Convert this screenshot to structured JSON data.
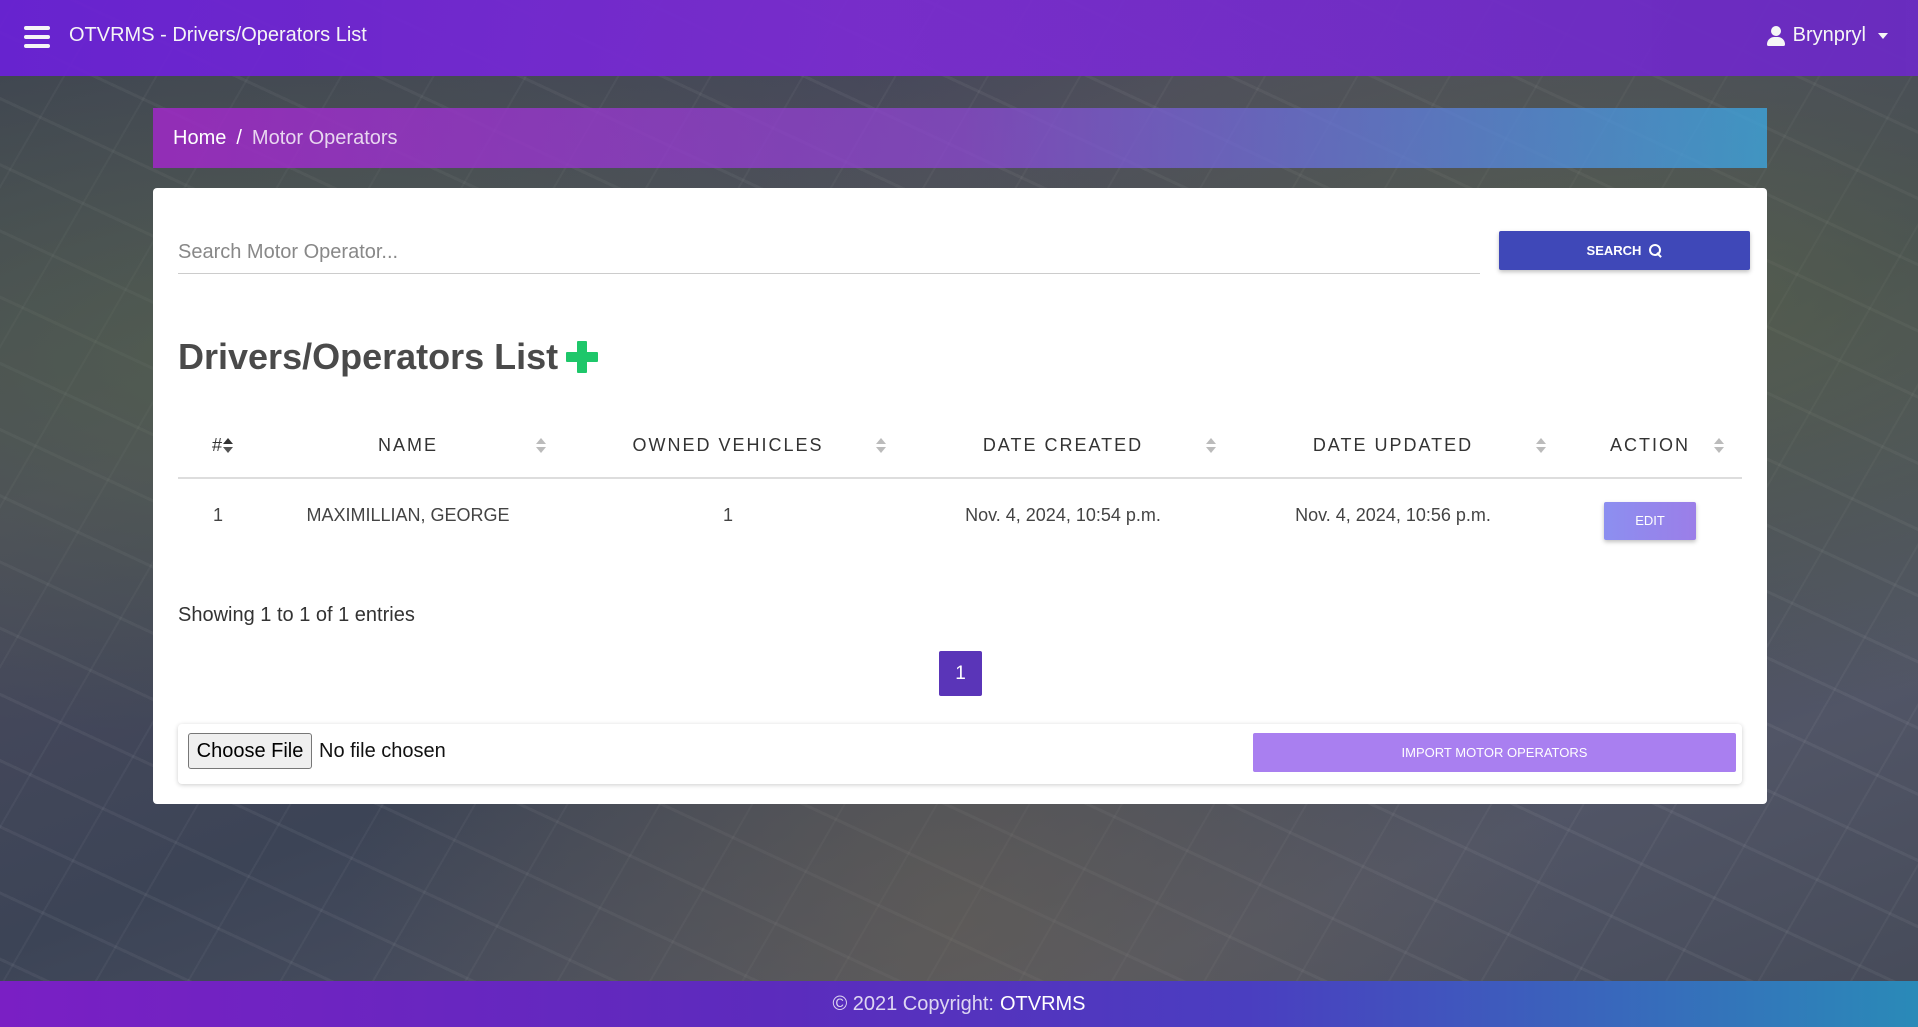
{
  "navbar": {
    "title": "OTVRMS - Drivers/Operators List",
    "user": "Brynpryl"
  },
  "breadcrumb": {
    "home": "Home",
    "separator": "/",
    "current": "Motor Operators"
  },
  "search": {
    "placeholder": "Search Motor Operator...",
    "button_label": "SEARCH"
  },
  "list": {
    "title": "Drivers/Operators List",
    "columns": [
      "#",
      "NAME",
      "OWNED VEHICLES",
      "DATE CREATED",
      "DATE UPDATED",
      "ACTION"
    ],
    "rows": [
      {
        "num": "1",
        "name": "MAXIMILLIAN, GEORGE",
        "owned_vehicles": "1",
        "date_created": "Nov. 4, 2024, 10:54 p.m.",
        "date_updated": "Nov. 4, 2024, 10:56 p.m.",
        "action": "EDIT"
      }
    ],
    "entries_info": "Showing 1 to 1 of 1 entries",
    "current_page": "1"
  },
  "import": {
    "choose_file_label": "Choose File",
    "no_file_text": "No file chosen",
    "button_label": "IMPORT MOTOR OPERATORS"
  },
  "footer": {
    "copyright": "© 2021 Copyright:",
    "brand": "OTVRMS"
  },
  "colors": {
    "navbar": "#6a22d6",
    "search_button": "#3f48b8",
    "add_icon": "#1ec76a",
    "page_active": "#5a35b8",
    "import_button": "#a97ff0"
  }
}
